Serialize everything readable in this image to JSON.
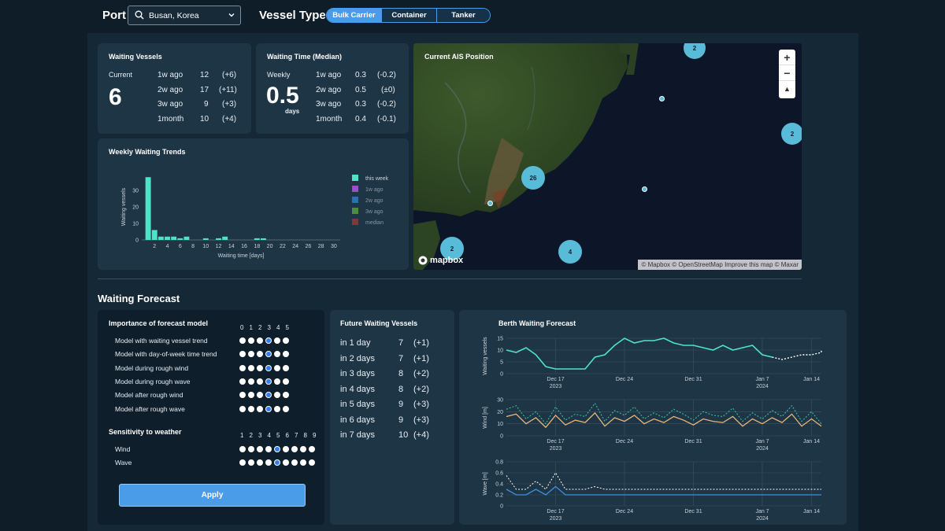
{
  "header": {
    "port_label": "Port",
    "port_value": "Busan, Korea",
    "vessel_type_label": "Vessel Type",
    "vessel_types": [
      "Bulk Carrier",
      "Container",
      "Tanker"
    ],
    "vessel_type_selected": "Bulk Carrier"
  },
  "waiting_vessels": {
    "title": "Waiting Vessels",
    "current_label": "Current",
    "current_value": "6",
    "history": [
      {
        "label": "1w ago",
        "value": "12",
        "delta": "(+6)"
      },
      {
        "label": "2w ago",
        "value": "17",
        "delta": "(+11)"
      },
      {
        "label": "3w ago",
        "value": "9",
        "delta": "(+3)"
      },
      {
        "label": "1month",
        "value": "10",
        "delta": "(+4)"
      }
    ]
  },
  "waiting_time": {
    "title": "Waiting Time (Median)",
    "weekly_label": "Weekly",
    "weekly_value": "0.5",
    "unit": "days",
    "history": [
      {
        "label": "1w ago",
        "value": "0.3",
        "delta": "(-0.2)"
      },
      {
        "label": "2w ago",
        "value": "0.5",
        "delta": "(±0)"
      },
      {
        "label": "3w ago",
        "value": "0.3",
        "delta": "(-0.2)"
      },
      {
        "label": "1month",
        "value": "0.4",
        "delta": "(-0.1)"
      }
    ]
  },
  "map": {
    "title": "Current AIS Position",
    "clusters": [
      "2",
      "2",
      "26",
      "2",
      "4"
    ],
    "zoom_in": "+",
    "zoom_out": "−",
    "compass": "▲",
    "logo": "mapbox",
    "attribution": "© Mapbox © OpenStreetMap Improve this map © Maxar"
  },
  "forecast_heading": "Waiting Forecast",
  "importance": {
    "title": "Importance of forecast model",
    "scale": [
      "0",
      "1",
      "2",
      "3",
      "4",
      "5"
    ],
    "rows": [
      {
        "label": "Model with waiting vessel trend",
        "selected": 3
      },
      {
        "label": "Model with day-of-week time trend",
        "selected": 3
      },
      {
        "label": "Model during rough wind",
        "selected": 3
      },
      {
        "label": "Model during rough wave",
        "selected": 3
      },
      {
        "label": "Model after rough wind",
        "selected": 3
      },
      {
        "label": "Model after rough wave",
        "selected": 3
      }
    ]
  },
  "sensitivity": {
    "title": "Sensitivity to weather",
    "scale": [
      "1",
      "2",
      "3",
      "4",
      "5",
      "6",
      "7",
      "8",
      "9"
    ],
    "rows": [
      {
        "label": "Wind",
        "selected": 5
      },
      {
        "label": "Wave",
        "selected": 5
      }
    ],
    "apply_label": "Apply"
  },
  "future": {
    "title": "Future Waiting Vessels",
    "rows": [
      {
        "label": "in 1 day",
        "value": "7",
        "delta": "(+1)"
      },
      {
        "label": "in 2 days",
        "value": "7",
        "delta": "(+1)"
      },
      {
        "label": "in 3 days",
        "value": "8",
        "delta": "(+2)"
      },
      {
        "label": "in 4 days",
        "value": "8",
        "delta": "(+2)"
      },
      {
        "label": "in 5 days",
        "value": "9",
        "delta": "(+3)"
      },
      {
        "label": "in 6 days",
        "value": "9",
        "delta": "(+3)"
      },
      {
        "label": "in 7 days",
        "value": "10",
        "delta": "(+4)"
      }
    ]
  },
  "berth_title": "Berth Waiting Forecast",
  "chart_data": [
    {
      "type": "bar",
      "title": "Weekly Waiting Trends",
      "xlabel": "Waiting time [days]",
      "ylabel": "Waiting vessels",
      "xlim": [
        0,
        31
      ],
      "ylim": [
        0,
        40
      ],
      "xticks": [
        2,
        4,
        6,
        8,
        10,
        12,
        14,
        16,
        18,
        20,
        22,
        24,
        26,
        28,
        30
      ],
      "yticks": [
        0,
        10,
        20,
        30
      ],
      "legend": [
        "this week",
        "1w ago",
        "2w ago",
        "3w ago",
        "median"
      ],
      "legend_colors": [
        "#4fe3c6",
        "#9b4dca",
        "#2a6fb8",
        "#4e8b3a",
        "#7a3b3b"
      ],
      "legend_placement": "right",
      "series": [
        {
          "name": "this week",
          "x": [
            1,
            2,
            3,
            4,
            5,
            6,
            7,
            10,
            12,
            13,
            18,
            19
          ],
          "values": [
            38,
            6,
            2,
            2,
            2,
            1,
            2,
            1,
            1,
            2,
            1,
            1
          ]
        }
      ]
    },
    {
      "type": "line",
      "ylabel": "Waiting vessels",
      "ylim": [
        0,
        15
      ],
      "yticks": [
        0,
        5,
        10,
        15
      ],
      "xlim": [
        0,
        32
      ],
      "xtick_pos": [
        5,
        12,
        19,
        26,
        31
      ],
      "xticks": [
        "Dec 17\n2023",
        "Dec 24",
        "Dec 31",
        "Jan 7\n2024",
        "Jan 14"
      ],
      "series": [
        {
          "name": "observed",
          "x": [
            0,
            1,
            2,
            3,
            4,
            5,
            6,
            7,
            8,
            9,
            10,
            11,
            12,
            13,
            14,
            15,
            16,
            17,
            18,
            19,
            20,
            21,
            22,
            23,
            24,
            25,
            26,
            27
          ],
          "values": [
            10,
            9,
            11,
            8,
            3,
            2,
            2,
            2,
            2,
            7,
            8,
            12,
            15,
            13,
            14,
            14,
            15,
            13,
            12,
            12,
            11,
            10,
            12,
            10,
            11,
            12,
            8,
            7
          ]
        },
        {
          "name": "forecast",
          "x": [
            27,
            28,
            29,
            30,
            31,
            32,
            33
          ],
          "values": [
            7,
            6,
            7,
            8,
            8,
            9,
            10
          ]
        }
      ]
    },
    {
      "type": "line",
      "ylabel": "Wind [m]",
      "ylim": [
        0,
        30
      ],
      "yticks": [
        0,
        10,
        20,
        30
      ],
      "xlim": [
        0,
        32
      ],
      "xtick_pos": [
        5,
        12,
        19,
        26,
        31
      ],
      "xticks": [
        "Dec 17\n2023",
        "Dec 24",
        "Dec 31",
        "Jan 7\n2024",
        "Jan 14"
      ],
      "series": [
        {
          "name": "gust",
          "values": [
            22,
            25,
            14,
            20,
            10,
            24,
            13,
            18,
            16,
            27,
            12,
            21,
            17,
            24,
            14,
            19,
            15,
            22,
            18,
            13,
            20,
            17,
            16,
            23,
            12,
            19,
            14,
            21,
            16,
            25,
            12,
            20,
            10
          ]
        },
        {
          "name": "mean",
          "values": [
            16,
            18,
            10,
            15,
            7,
            17,
            9,
            13,
            11,
            19,
            8,
            15,
            12,
            17,
            10,
            14,
            11,
            16,
            13,
            9,
            14,
            12,
            11,
            16,
            8,
            14,
            10,
            15,
            11,
            18,
            8,
            14,
            8
          ]
        }
      ]
    },
    {
      "type": "line",
      "ylabel": "Wave [m]",
      "ylim": [
        0,
        0.8
      ],
      "yticks": [
        0,
        0.2,
        0.4,
        0.6,
        0.8
      ],
      "xlim": [
        0,
        32
      ],
      "xtick_pos": [
        5,
        12,
        19,
        26,
        31
      ],
      "xticks": [
        "Dec 17\n2023",
        "Dec 24",
        "Dec 31",
        "Jan 7\n2024",
        "Jan 14"
      ],
      "series": [
        {
          "name": "max",
          "values": [
            0.55,
            0.3,
            0.3,
            0.45,
            0.3,
            0.6,
            0.3,
            0.3,
            0.3,
            0.35,
            0.3,
            0.3,
            0.3,
            0.3,
            0.3,
            0.3,
            0.3,
            0.3,
            0.3,
            0.3,
            0.3,
            0.3,
            0.3,
            0.3,
            0.3,
            0.3,
            0.3,
            0.3,
            0.3,
            0.3,
            0.3,
            0.3,
            0.3
          ]
        },
        {
          "name": "mean",
          "values": [
            0.3,
            0.2,
            0.2,
            0.3,
            0.2,
            0.35,
            0.2,
            0.2,
            0.2,
            0.2,
            0.2,
            0.2,
            0.2,
            0.2,
            0.2,
            0.2,
            0.2,
            0.2,
            0.2,
            0.2,
            0.2,
            0.2,
            0.2,
            0.2,
            0.2,
            0.2,
            0.2,
            0.2,
            0.2,
            0.2,
            0.2,
            0.2,
            0.2
          ]
        }
      ]
    }
  ]
}
